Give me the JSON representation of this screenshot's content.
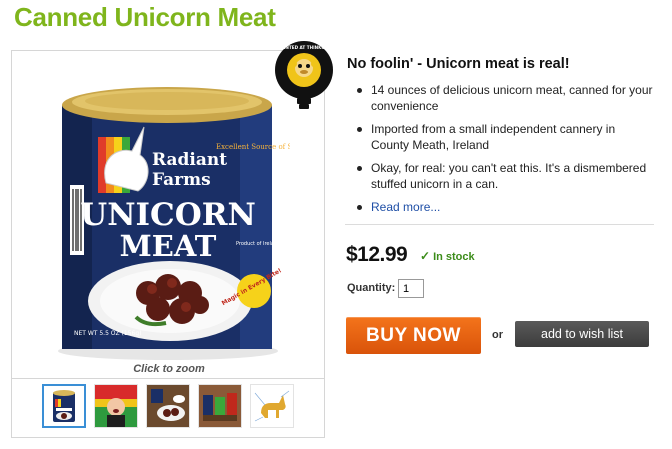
{
  "product": {
    "title": "Canned Unicorn Meat",
    "tagline": "No foolin' - Unicorn meat is real!",
    "features": [
      "14 ounces of delicious unicorn meat, canned for your convenience",
      "Imported from a small independent cannery in County Meath, Ireland",
      "Okay, for real: you can't eat this. It's a dismembered stuffed unicorn in a can."
    ],
    "read_more": "Read more...",
    "price": "$12.99",
    "stock": "In stock",
    "stock_mark": "✓"
  },
  "gallery": {
    "zoom_caption": "Click to zoom",
    "thumbnails": [
      "can",
      "person",
      "scene",
      "cans",
      "diagram"
    ]
  },
  "can": {
    "brand_line1": "Radiant",
    "brand_line2": "Farms",
    "side_text": "Excellent Source of Sparkles",
    "line1": "UNICORN",
    "line2": "MEAT",
    "origin": "Product of Ireland",
    "sticker": "Magic in Every Bite!",
    "weight": "NET WT 5.5 OZ (156g)"
  },
  "badge": {
    "text": "INVENTED AT THINKGEEK"
  },
  "purchase": {
    "qty_label": "Quantity:",
    "qty_value": "1",
    "buy_label": "BUY NOW",
    "or_label": "or",
    "wish_label": "add to wish list"
  },
  "colors": {
    "title_green": "#7fb51c",
    "buy_orange": "#e8620f",
    "stock_green": "#3c8c1a",
    "link_blue": "#1f4fa6",
    "can_navy": "#1a2f66"
  }
}
